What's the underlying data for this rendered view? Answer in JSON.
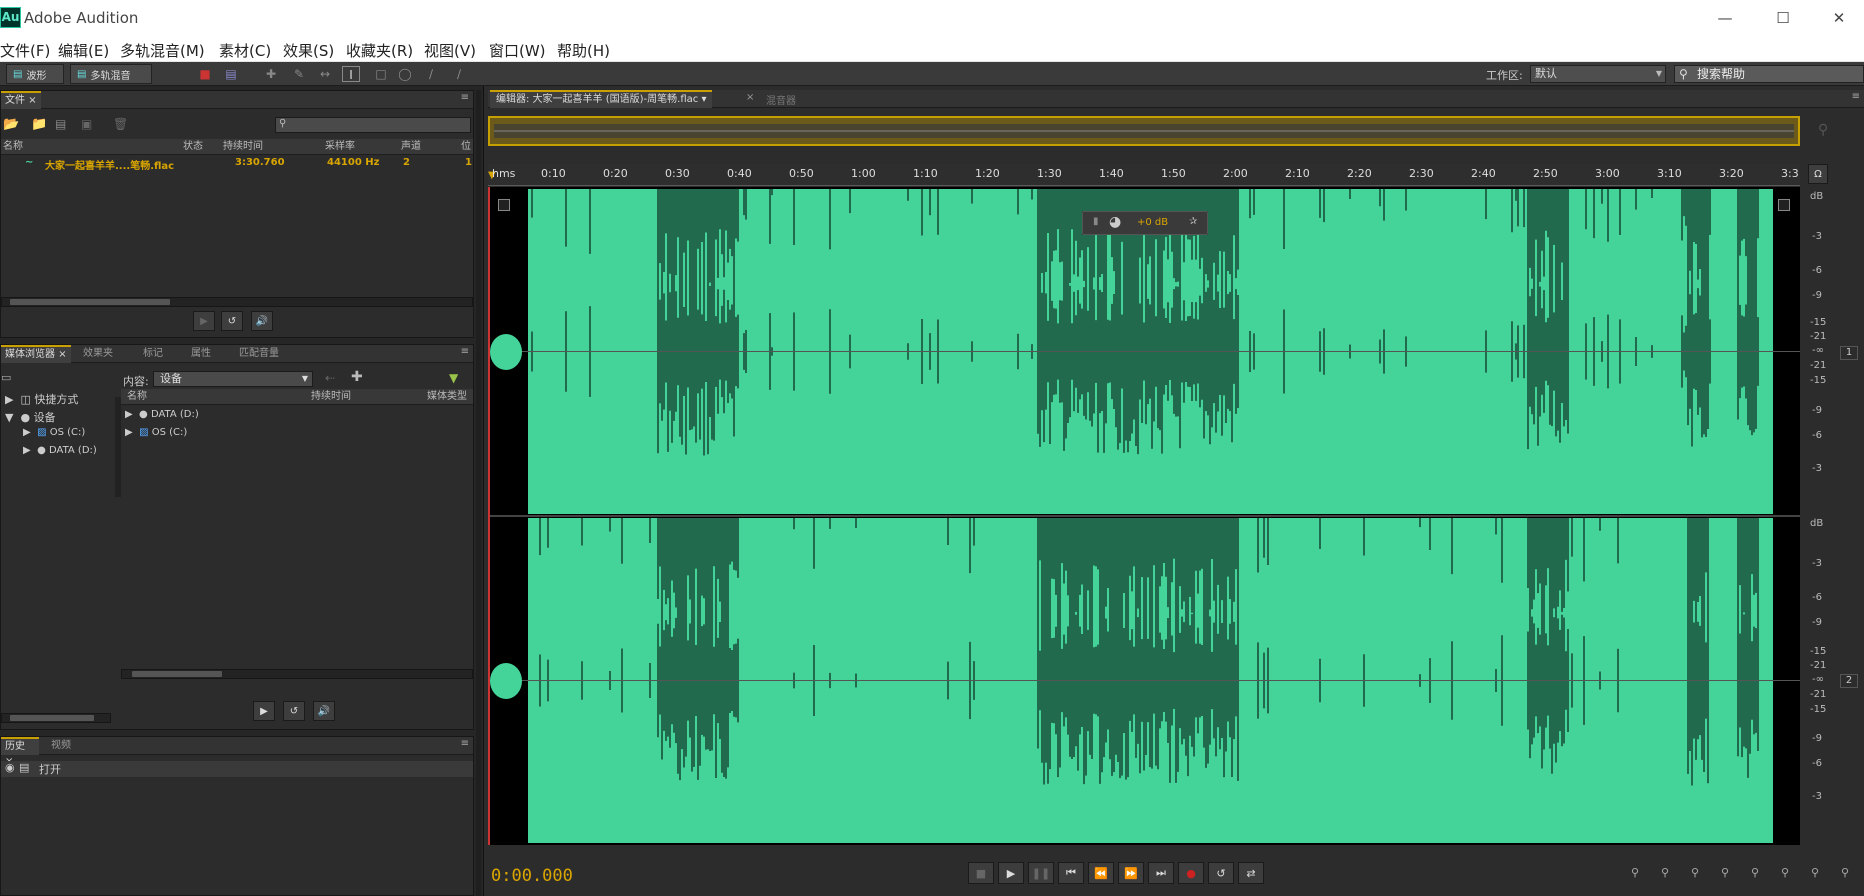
{
  "app": {
    "logo_text": "Au",
    "title": "Adobe Audition"
  },
  "menu": [
    "文件(F)",
    "编辑(E)",
    "多轨混音(M)",
    "素材(C)",
    "效果(S)",
    "收藏夹(R)",
    "视图(V)",
    "窗口(W)",
    "帮助(H)"
  ],
  "toolbar": {
    "waveform_label": "波形",
    "multitrack_label": "多轨混音",
    "workspace_label": "工作区:",
    "workspace_value": "默认",
    "help_search": "搜索帮助"
  },
  "files_panel": {
    "tab": "文件",
    "columns": [
      "名称",
      "状态",
      "持续时间",
      "采样率",
      "声道",
      "位"
    ],
    "file": {
      "name": "大家一起喜羊羊....笔畅.flac",
      "duration": "3:30.760",
      "sample_rate": "44100 Hz",
      "channels": "2",
      "bits": "1"
    }
  },
  "media_panel": {
    "tabs": [
      "媒体浏览器",
      "效果夹",
      "标记",
      "属性",
      "匹配音量"
    ],
    "content_label": "内容:",
    "content_value": "设备",
    "tree": [
      "快捷方式",
      "设备",
      "OS (C:)",
      "DATA (D:)"
    ],
    "columns": [
      "名称",
      "持续时间",
      "媒体类型"
    ],
    "items": [
      "DATA (D:)",
      "OS (C:)"
    ]
  },
  "history_panel": {
    "tabs": [
      "历史",
      "视频"
    ],
    "items": [
      "打开"
    ]
  },
  "editor": {
    "tab": "编辑器: 大家一起喜羊羊 (国语版)-周笔畅.flac",
    "mixer_tab": "混音器",
    "hud_value": "+0 dB",
    "ruler_labels": [
      "hms",
      "0:10",
      "0:20",
      "0:30",
      "0:40",
      "0:50",
      "1:00",
      "1:10",
      "1:20",
      "1:30",
      "1:40",
      "1:50",
      "2:00",
      "2:10",
      "2:20",
      "2:30",
      "2:40",
      "2:50",
      "3:00",
      "3:10",
      "3:20",
      "3:3"
    ],
    "db_scale": [
      "dB",
      "-3",
      "-6",
      "-9",
      "-15",
      "-21",
      "-∞",
      "-21",
      "-15",
      "-9",
      "-6",
      "-3"
    ],
    "channels": [
      "1",
      "2"
    ],
    "time": "0:00.000",
    "wave_color": "#44d49a"
  }
}
